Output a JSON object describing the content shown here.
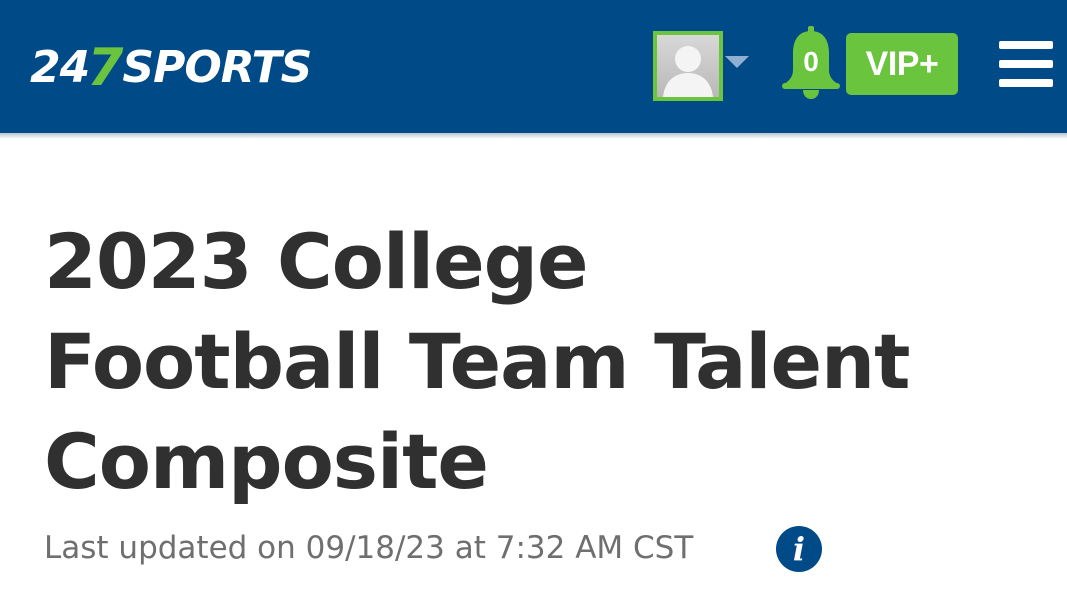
{
  "header": {
    "logo": {
      "num": "24",
      "seven": "7",
      "word": "SPORTS"
    },
    "notifications": {
      "count": "0"
    },
    "vip_label": "VIP+",
    "colors": {
      "bar": "#004a87",
      "accent": "#6ac43e"
    }
  },
  "main": {
    "title_lines": [
      "2023 College",
      "Football Team Talent",
      "Composite"
    ],
    "last_updated": "Last updated on 09/18/23 at 7:32 AM CST",
    "info_glyph": "i"
  }
}
